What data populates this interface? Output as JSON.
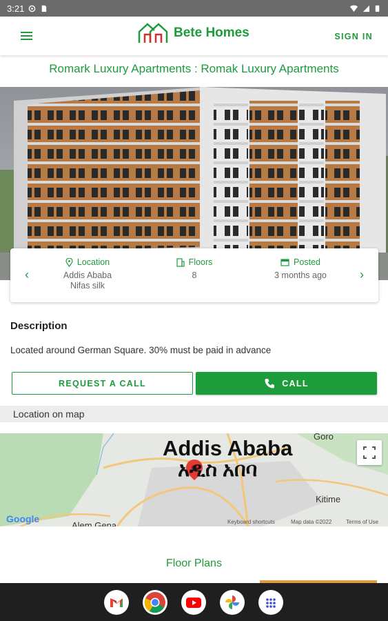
{
  "status_bar": {
    "time": "3:21"
  },
  "app_bar": {
    "brand": "Bete Homes",
    "sign_in": "SIGN IN"
  },
  "property": {
    "title": "Romark Luxury Apartments : Romak Luxury Apartments",
    "location_label": "Location",
    "location_value_1": "Addis Ababa",
    "location_value_2": "Nifas silk",
    "floors_label": "Floors",
    "floors_value": "8",
    "posted_label": "Posted",
    "posted_value": "3 months ago"
  },
  "description": {
    "title": "Description",
    "text": "Located around German Square. 30% must be paid in advance"
  },
  "actions": {
    "request_call": "REQUEST A CALL",
    "call": "CALL"
  },
  "map": {
    "section_label": "Location on map",
    "city_en": "Addis Ababa",
    "city_am": "አዲስ አበባ",
    "label_goro": "Goro",
    "label_kitime": "Kitime",
    "label_alem": "Alem Gena",
    "google": "Google",
    "footer_shortcuts": "Keyboard shortcuts",
    "footer_data": "Map data ©2022",
    "footer_terms": "Terms of Use"
  },
  "floor_plans": {
    "title": "Floor Plans"
  },
  "dock": [
    "gmail-app",
    "chrome-app",
    "youtube-app",
    "photos-app",
    "app-drawer"
  ],
  "colors": {
    "accent": "#1e9b3a",
    "status_bar": "#6b6b6b",
    "nav_bar": "#1f1f1f"
  }
}
